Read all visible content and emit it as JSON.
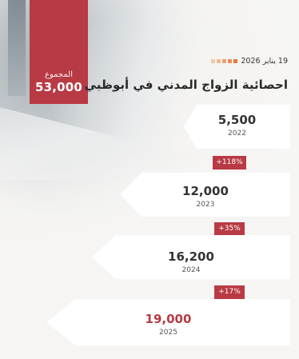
{
  "header": {
    "date": "19 يناير 2026",
    "title": "احصائية الزواج المدني في أبوظبي",
    "dot_colors": [
      "#f0c8a8",
      "#eeb98e",
      "#eba474",
      "#e88e5a",
      "#e5793f"
    ]
  },
  "total": {
    "label": "المجموع",
    "value": "53,000"
  },
  "years": [
    {
      "value": "5,500",
      "year": "2022"
    },
    {
      "value": "12,000",
      "year": "2023"
    },
    {
      "value": "16,200",
      "year": "2024"
    },
    {
      "value": "19,000",
      "year": "2025"
    }
  ],
  "growth": [
    {
      "label": "+118%"
    },
    {
      "label": "+35%"
    },
    {
      "label": "+17%"
    }
  ],
  "colors": {
    "accent": "#b83a44",
    "card": "#ffffff",
    "background": "#f6f5f3"
  }
}
